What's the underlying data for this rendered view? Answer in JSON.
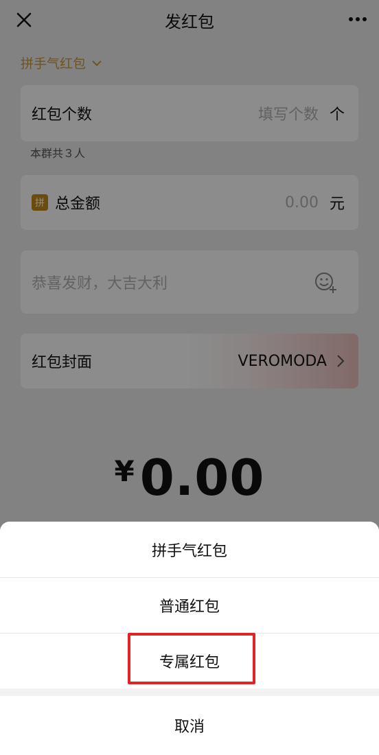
{
  "nav": {
    "title": "发红包",
    "close_icon": "close-icon",
    "more_icon": "more-icon"
  },
  "type_selector": {
    "label": "拼手气红包",
    "chevron_icon": "chevron-down-icon"
  },
  "count_field": {
    "label": "红包个数",
    "placeholder": "填写个数",
    "unit": "个",
    "hint": "本群共３人"
  },
  "amount_field": {
    "badge": "拼",
    "label": "总金额",
    "placeholder": "0.00",
    "unit": "元"
  },
  "greeting_field": {
    "placeholder": "恭喜发财，大吉大利",
    "emoji_icon": "emoji-add-icon"
  },
  "cover_field": {
    "label": "红包封面",
    "value": "VEROMODA",
    "chevron_icon": "chevron-right-icon"
  },
  "total": {
    "currency": "¥",
    "amount": "0.00"
  },
  "action_sheet": {
    "options": [
      {
        "label": "拼手气红包"
      },
      {
        "label": "普通红包"
      },
      {
        "label": "专属红包"
      }
    ],
    "cancel_label": "取消",
    "highlighted_option": "专属红包"
  },
  "colors": {
    "accent_gold": "#c99a3b",
    "highlight_red": "#e02424"
  }
}
